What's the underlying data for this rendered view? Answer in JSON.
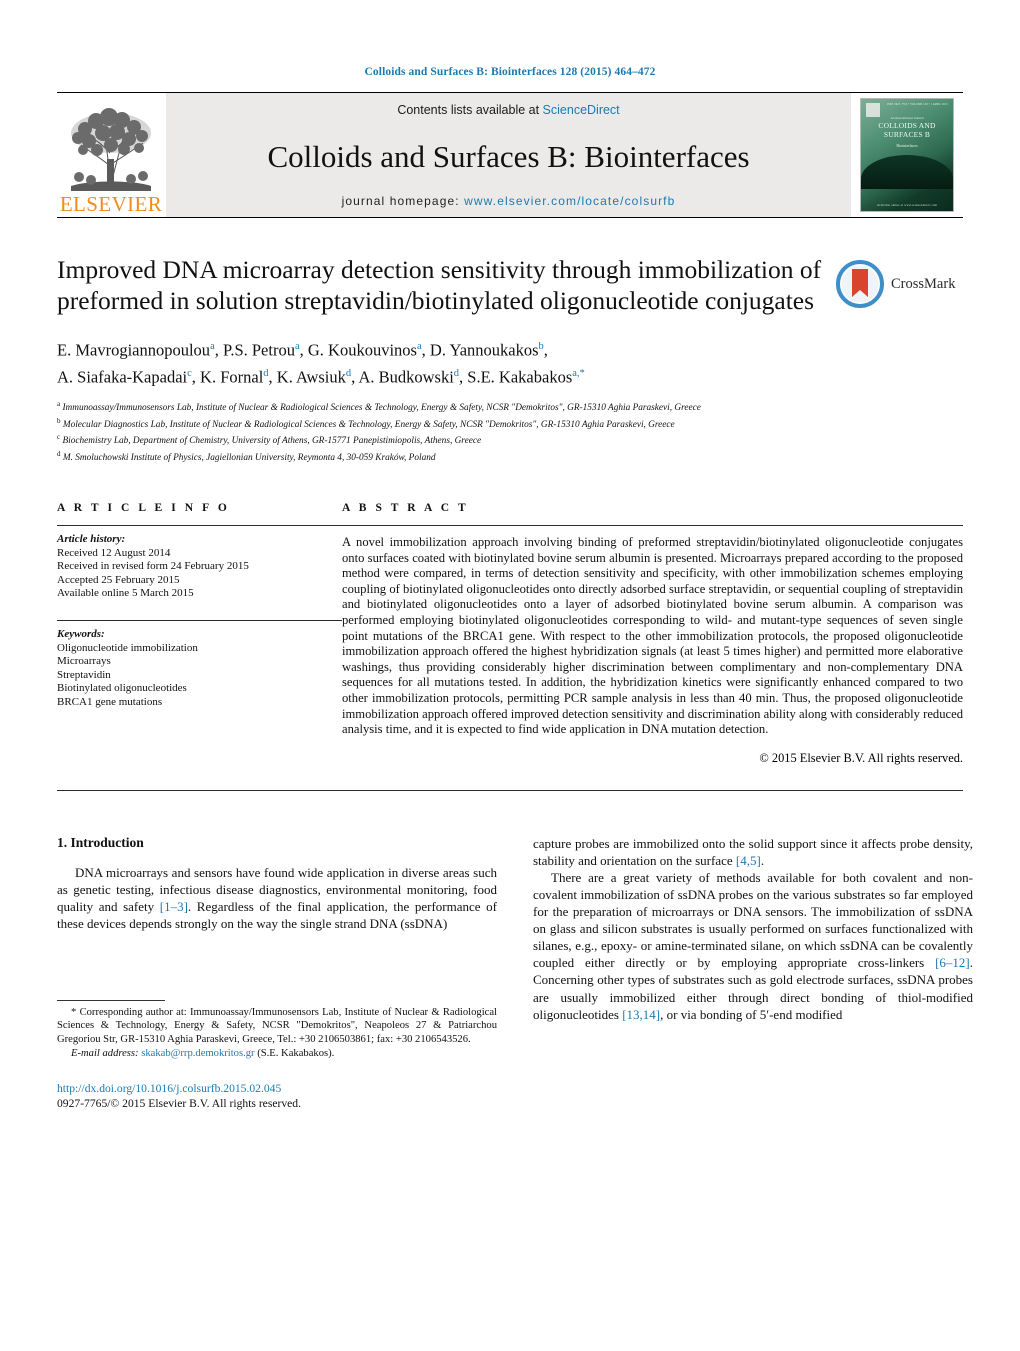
{
  "running_head": "Colloids and Surfaces B: Biointerfaces 128 (2015) 464–472",
  "banner": {
    "publisher_name": "ELSEVIER",
    "contents_prefix": "Contents lists available at ",
    "contents_link": "ScienceDirect",
    "journal_title": "Colloids and Surfaces B: Biointerfaces",
    "homepage_label": "journal homepage:",
    "homepage_url": "www.elsevier.com/locate/colsurfb",
    "cover": {
      "top_line": "ISSN 0927-7765 • VOLUME 128 • 1 APRIL 2015",
      "small_label": "An International Journal",
      "title_line1": "COLLOIDS AND",
      "title_line2": "SURFACES B",
      "editors": "Biointerfaces",
      "footer": "Available online at www.sciencedirect.com"
    }
  },
  "article": {
    "title": "Improved DNA microarray detection sensitivity through immobilization of preformed in solution streptavidin/biotinylated oligonucleotide conjugates",
    "crossmark_label": "CrossMark",
    "authors_line1_parts": [
      {
        "name": "E. Mavrogiannopoulou",
        "sup": "a"
      },
      {
        "name": "P.S. Petrou",
        "sup": "a"
      },
      {
        "name": "G. Koukouvinos",
        "sup": "a"
      },
      {
        "name": "D. Yannoukakos",
        "sup": "b"
      }
    ],
    "authors_line2_parts": [
      {
        "name": "A. Siafaka-Kapadai",
        "sup": "c"
      },
      {
        "name": "K. Fornal",
        "sup": "d"
      },
      {
        "name": "K. Awsiuk",
        "sup": "d"
      },
      {
        "name": "A. Budkowski",
        "sup": "d"
      },
      {
        "name": "S.E. Kakabakos",
        "sup": "a,*"
      }
    ],
    "affiliations": [
      {
        "mark": "a",
        "text": "Immunoassay/Immunosensors Lab, Institute of Nuclear & Radiological Sciences & Technology, Energy & Safety, NCSR \"Demokritos\", GR-15310 Aghia Paraskevi, Greece"
      },
      {
        "mark": "b",
        "text": "Molecular Diagnostics Lab, Institute of Nuclear & Radiological Sciences & Technology, Energy & Safety, NCSR \"Demokritos\", GR-15310 Aghia Paraskevi, Greece"
      },
      {
        "mark": "c",
        "text": "Biochemistry Lab, Department of Chemistry, University of Athens, GR-15771 Panepistimiopolis, Athens, Greece"
      },
      {
        "mark": "d",
        "text": "M. Smoluchowski Institute of Physics, Jagiellonian University, Reymonta 4, 30-059 Kraków, Poland"
      }
    ]
  },
  "article_info": {
    "heading": "A R T I C L E  I N F O",
    "history_label": "Article history:",
    "history": [
      "Received 12 August 2014",
      "Received in revised form 24 February 2015",
      "Accepted 25 February 2015",
      "Available online 5 March 2015"
    ],
    "keywords_label": "Keywords:",
    "keywords": [
      "Oligonucleotide immobilization",
      "Microarrays",
      "Streptavidin",
      "Biotinylated oligonucleotides",
      "BRCA1 gene mutations"
    ]
  },
  "abstract": {
    "heading": "A B S T R A C T",
    "text": "A novel immobilization approach involving binding of preformed streptavidin/biotinylated oligonucleotide conjugates onto surfaces coated with biotinylated bovine serum albumin is presented. Microarrays prepared according to the proposed method were compared, in terms of detection sensitivity and specificity, with other immobilization schemes employing coupling of biotinylated oligonucleotides onto directly adsorbed surface streptavidin, or sequential coupling of streptavidin and biotinylated oligonucleotides onto a layer of adsorbed biotinylated bovine serum albumin. A comparison was performed employing biotinylated oligonucleotides corresponding to wild- and mutant-type sequences of seven single point mutations of the BRCA1 gene. With respect to the other immobilization protocols, the proposed oligonucleotide immobilization approach offered the highest hybridization signals (at least 5 times higher) and permitted more elaborative washings, thus providing considerably higher discrimination between complimentary and non-complementary DNA sequences for all mutations tested. In addition, the hybridization kinetics were significantly enhanced compared to two other immobilization protocols, permitting PCR sample analysis in less than 40 min. Thus, the proposed oligonucleotide immobilization approach offered improved detection sensitivity and discrimination ability along with considerably reduced analysis time, and it is expected to find wide application in DNA mutation detection.",
    "copyright": "© 2015 Elsevier B.V. All rights reserved."
  },
  "introduction": {
    "heading": "1.  Introduction",
    "left_para1_a": "DNA microarrays and sensors have found wide application in diverse areas such as genetic testing, infectious disease diagnostics, environmental monitoring, food quality and safety ",
    "left_para1_ref": "[1–3]",
    "left_para1_b": ". Regardless of the final application, the performance of these devices depends strongly on the way the single strand DNA (ssDNA)",
    "right_para1_a": "capture probes are immobilized onto the solid support since it affects probe density, stability and orientation on the surface ",
    "right_para1_ref": "[4,5]",
    "right_para1_b": ".",
    "right_para2_a": "There are a great variety of methods available for both covalent and non-covalent immobilization of ssDNA probes on the various substrates so far employed for the preparation of microarrays or DNA sensors. The immobilization of ssDNA on glass and silicon substrates is usually performed on surfaces functionalized with silanes, e.g., epoxy- or amine-terminated silane, on which ssDNA can be covalently coupled either directly or by employing appropriate cross-linkers ",
    "right_para2_ref1": "[6–12]",
    "right_para2_b": ". Concerning other types of substrates such as gold electrode surfaces, ssDNA probes are usually immobilized either through direct bonding of thiol-modified oligonucleotides ",
    "right_para2_ref2": "[13,14]",
    "right_para2_c": ", or via bonding of 5′-end modified"
  },
  "footnote": {
    "star": "*",
    "corresponding": "Corresponding author at: Immunoassay/Immunosensors Lab, Institute of Nuclear & Radiological Sciences & Technology, Energy & Safety, NCSR \"Demokritos\", Neapoleos 27 & Patriarchou Gregoriou Str, GR-15310 Aghia Paraskevi, Greece, Tel.: +30 2106503861; fax: +30 2106543526.",
    "email_label": "E-mail address:",
    "email": "skakab@rrp.demokritos.gr",
    "email_owner": "(S.E. Kakabakos).",
    "doi": "http://dx.doi.org/10.1016/j.colsurfb.2015.02.045",
    "issn": "0927-7765/© 2015 Elsevier B.V. All rights reserved."
  },
  "colors": {
    "link_blue": "#1c7ab0",
    "elsevier_orange": "#f08c1b",
    "banner_grey": "#eceae8"
  }
}
